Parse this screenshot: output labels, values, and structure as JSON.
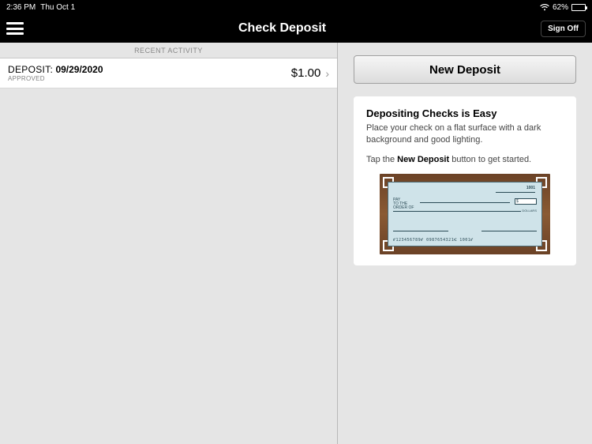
{
  "statusbar": {
    "time": "2:36 PM",
    "date": "Thu Oct 1",
    "battery_pct": "62%"
  },
  "navbar": {
    "title": "Check Deposit",
    "signoff": "Sign Off"
  },
  "left": {
    "section_header": "RECENT ACTIVITY",
    "items": [
      {
        "label": "DEPOSIT:",
        "date": "09/29/2020",
        "status": "APPROVED",
        "amount": "$1.00"
      }
    ]
  },
  "right": {
    "new_deposit_label": "New Deposit",
    "card": {
      "heading": "Depositing Checks is Easy",
      "line1": "Place your check on a flat surface with a dark background and good lighting.",
      "line2a": "Tap the ",
      "line2b": "New Deposit",
      "line2c": " button to get started."
    },
    "check": {
      "number": "1001",
      "pay_label": "PAY\nTO THE\nORDER OF",
      "dollars_label": "DOLLARS",
      "micr": "⑈123456789⑈   0987654321⑆   1001⑈"
    }
  }
}
